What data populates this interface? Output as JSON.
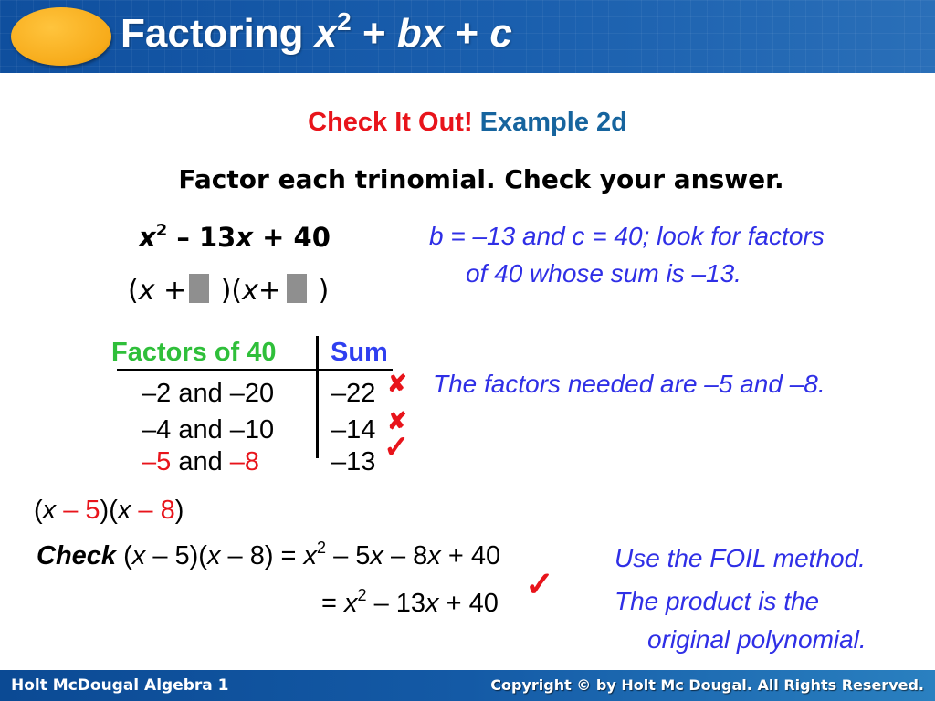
{
  "header": {
    "title_prefix": "Factoring ",
    "title_var_x": "x",
    "title_exp": "2",
    "title_plus1": " + ",
    "title_bx": "bx",
    "title_plus2": " + ",
    "title_c": "c"
  },
  "heading": {
    "check_it_out": "Check It Out!",
    "example": "Example 2d"
  },
  "instruction": "Factor each trinomial. Check your answer.",
  "problem": {
    "x": "x",
    "exp": "2",
    "rest_a": " – 13",
    "x2": "x",
    "rest_b": " + 40"
  },
  "blanks": {
    "open1": "(",
    "x1": "x",
    "plus1": " +",
    "close_open": " )(",
    "x2": "x",
    "plus2": "+",
    "close": " )"
  },
  "notes": {
    "bc_line1": "b = –13 and c = 40; look for factors",
    "bc_line2": "of 40 whose sum is –13.",
    "factors_needed": "The factors needed are –5 and –8.",
    "foil": "Use the FOIL method.",
    "product_line1": "The product is the",
    "product_line2": "original polynomial."
  },
  "table": {
    "col_factors": "Factors of 40",
    "col_sum": "Sum",
    "rows": [
      {
        "a": "–2",
        "and": " and ",
        "b": "–20",
        "sum": "–22",
        "result": "incorrect",
        "highlight": false
      },
      {
        "a": "–4",
        "and": " and ",
        "b": "–10",
        "sum": "–14",
        "result": "incorrect",
        "highlight": false
      },
      {
        "a": "–5",
        "and": " and ",
        "b": "–8",
        "sum": "–13",
        "result": "correct",
        "highlight": true
      }
    ],
    "mark_incorrect": "✘",
    "mark_correct": "✓"
  },
  "answer": {
    "open": "(",
    "x1": "x",
    "m1": " – 5",
    "mid": ")(",
    "x2": "x",
    "m2": " – 8",
    "close": ")"
  },
  "check": {
    "label": "Check",
    "line1_a": " (",
    "line1_x1": "x",
    "line1_b": " – 5)(",
    "line1_x2": "x",
    "line1_c": " – 8) = ",
    "line1_x3": "x",
    "line1_exp": "2",
    "line1_d": " – 5",
    "line1_x4": "x",
    "line1_e": " – 8",
    "line1_x5": "x",
    "line1_f": " + 40",
    "line2_a": "= ",
    "line2_x1": "x",
    "line2_exp": "2",
    "line2_b": " – 13",
    "line2_x2": "x",
    "line2_c": " + 40",
    "mark": "✓"
  },
  "footer": {
    "left": "Holt McDougal Algebra 1",
    "right": "Copyright © by Holt Mc Dougal. All Rights Reserved."
  },
  "colors": {
    "header_blue": "#1a5fae",
    "logo_orange": "#f7ab1a",
    "red": "#e8141b",
    "example_blue": "#16649e",
    "note_blue": "#2f2fe6",
    "green": "#2fbf3a"
  }
}
